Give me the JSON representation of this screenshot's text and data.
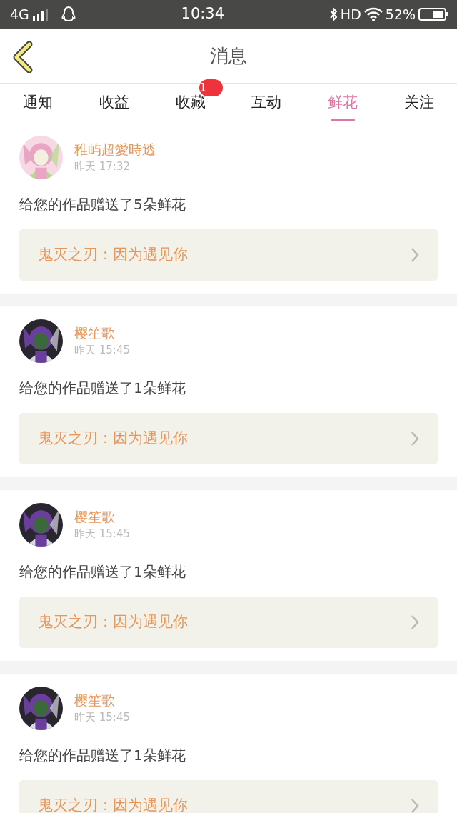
{
  "status_bar": {
    "network": "4G",
    "time": "10:34",
    "hd": "HD",
    "battery": "52%"
  },
  "header": {
    "title": "消息"
  },
  "tabs": [
    {
      "label": "通知",
      "selected": false
    },
    {
      "label": "收益",
      "selected": false
    },
    {
      "label": "收藏",
      "selected": false,
      "badge": "1"
    },
    {
      "label": "互动",
      "selected": false
    },
    {
      "label": "鲜花",
      "selected": true
    },
    {
      "label": "关注",
      "selected": false
    }
  ],
  "messages": [
    {
      "user": "稚屿超愛時透",
      "time": "昨天 17:32",
      "text": "给您的作品赠送了5朵鲜花",
      "work": "鬼灭之刃：因为遇见你"
    },
    {
      "user": "樱笙歌",
      "time": "昨天 15:45",
      "text": "给您的作品赠送了1朵鲜花",
      "work": "鬼灭之刃：因为遇见你"
    },
    {
      "user": "樱笙歌",
      "time": "昨天 15:45",
      "text": "给您的作品赠送了1朵鲜花",
      "work": "鬼灭之刃：因为遇见你"
    },
    {
      "user": "樱笙歌",
      "time": "昨天 15:45",
      "text": "给您的作品赠送了1朵鲜花",
      "work": "鬼灭之刃：因为遇见你"
    }
  ]
}
